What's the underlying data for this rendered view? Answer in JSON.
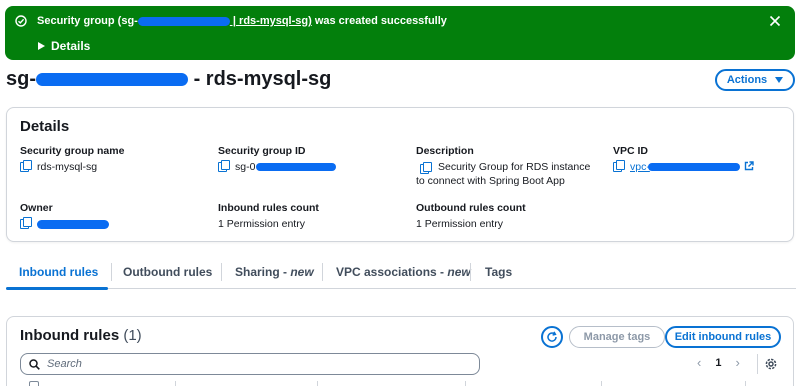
{
  "banner": {
    "message_prefix": "Security group (sg-",
    "message_link_suffix": " | rds-mysql-sg)",
    "message_suffix": " was created successfully",
    "details_label": "Details",
    "icons": {
      "status": "success-check-icon",
      "dismiss": "close-icon",
      "expand": "caret-right-icon"
    },
    "color": "#037f0c"
  },
  "page": {
    "title_prefix": "sg-",
    "title_suffix": "- rds-mysql-sg",
    "actions_label": "Actions"
  },
  "details": {
    "heading": "Details",
    "fields": {
      "sg_name": {
        "label": "Security group name",
        "value": "rds-mysql-sg"
      },
      "sg_id": {
        "label": "Security group ID",
        "value": "sg-0"
      },
      "description": {
        "label": "Description",
        "value": "Security Group for RDS instance to connect with Spring Boot App"
      },
      "vpc_id": {
        "label": "VPC ID",
        "value": "vpc-"
      },
      "owner": {
        "label": "Owner",
        "value": ""
      },
      "inbound_count": {
        "label": "Inbound rules count",
        "value": "1 Permission entry"
      },
      "outbound_count": {
        "label": "Outbound rules count",
        "value": "1 Permission entry"
      }
    }
  },
  "tabs": {
    "items": [
      {
        "label": "Inbound rules",
        "suffix": "",
        "active": true
      },
      {
        "label": "Outbound rules",
        "suffix": ""
      },
      {
        "label": "Sharing - ",
        "suffix": "new"
      },
      {
        "label": "VPC associations - ",
        "suffix": "new"
      },
      {
        "label": "Tags",
        "suffix": ""
      }
    ]
  },
  "inbound": {
    "title": "Inbound rules",
    "count": "(1)",
    "manage_tags_label": "Manage tags",
    "edit_label": "Edit inbound rules",
    "search_placeholder": "Search",
    "page_number": "1"
  },
  "colors": {
    "accent": "#0972d3",
    "success": "#037f0c",
    "redaction": "#0a6cf2"
  }
}
